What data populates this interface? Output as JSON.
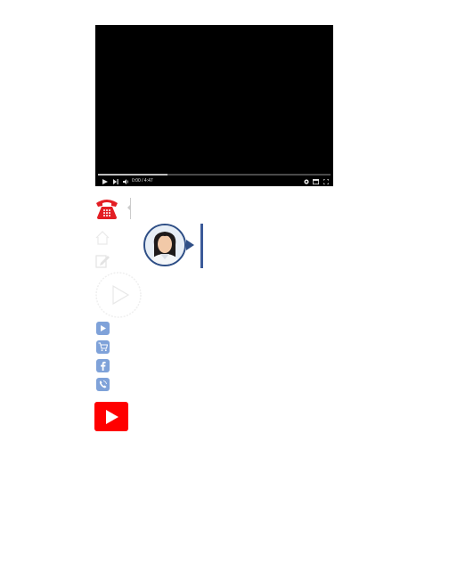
{
  "player": {
    "time": "0:00 / 4:47",
    "progress": 0.3,
    "icons": {
      "play": "play-icon",
      "next": "next-icon",
      "volume": "volume-icon",
      "settings": "settings-icon",
      "theater": "theater-icon",
      "fullscreen": "fullscreen-icon"
    }
  },
  "contact": {
    "phone_icon": "telephone-icon",
    "phone_color": "#e31e24",
    "avatar": "avatar",
    "accent": "#2f4f86"
  },
  "faint_icons": [
    "home-icon",
    "edit-icon",
    "play-circle-icon"
  ],
  "social_icons": [
    "video-icon",
    "cart-icon",
    "facebook-icon",
    "viber-icon"
  ],
  "social_color": "#7fa2d9",
  "youtube": {
    "icon": "youtube-icon",
    "color": "#ff0000"
  }
}
